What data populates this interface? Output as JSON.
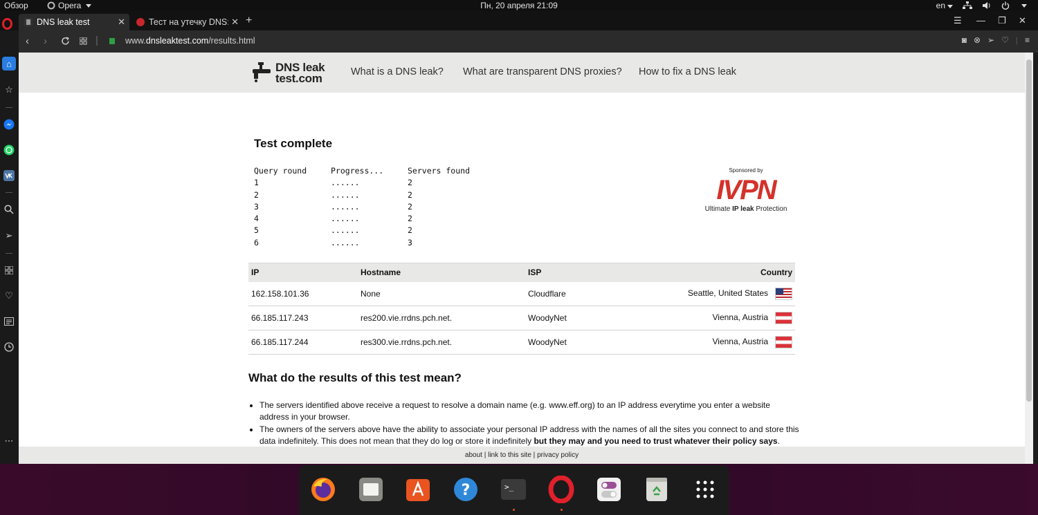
{
  "system": {
    "overview_label": "Обзор",
    "app_menu_label": "Opera",
    "clock": "Пн, 20 апреля  21:09",
    "keyboard_layout": "en"
  },
  "browser": {
    "tabs": [
      {
        "label": "DNS leak test",
        "active": true
      },
      {
        "label": "Тест на утечку DNS: Ка",
        "active": false
      }
    ],
    "new_tab_label": "+",
    "url_prefix": "www.",
    "url_host": "dnsleaktest.com",
    "url_path": "/results.html"
  },
  "site": {
    "logo_line1": "DNS leak",
    "logo_line2": "test.com",
    "nav": [
      "What is a DNS leak?",
      "What are transparent DNS proxies?",
      "How to fix a DNS leak"
    ]
  },
  "test": {
    "title": "Test complete",
    "query_headers": [
      "Query round",
      "Progress...",
      "Servers found"
    ],
    "query_rows": [
      [
        "1",
        "......",
        "2"
      ],
      [
        "2",
        "......",
        "2"
      ],
      [
        "3",
        "......",
        "2"
      ],
      [
        "4",
        "......",
        "2"
      ],
      [
        "5",
        "......",
        "2"
      ],
      [
        "6",
        "......",
        "3"
      ]
    ]
  },
  "sponsor": {
    "by": "Sponsored by",
    "brand": "IVPN",
    "tagline_pre": "Ultimate ",
    "tagline_bold": "IP leak",
    "tagline_post": " Protection"
  },
  "results": {
    "headers": {
      "ip": "IP",
      "hostname": "Hostname",
      "isp": "ISP",
      "country": "Country"
    },
    "rows": [
      {
        "ip": "162.158.101.36",
        "hostname": "None",
        "isp": "Cloudflare",
        "country": "Seattle, United States",
        "flag": "us"
      },
      {
        "ip": "66.185.117.243",
        "hostname": "res200.vie.rrdns.pch.net.",
        "isp": "WoodyNet",
        "country": "Vienna, Austria",
        "flag": "at"
      },
      {
        "ip": "66.185.117.244",
        "hostname": "res300.vie.rrdns.pch.net.",
        "isp": "WoodyNet",
        "country": "Vienna, Austria",
        "flag": "at"
      }
    ]
  },
  "meaning": {
    "title": "What do the results of this test mean?",
    "item1": "The servers identified above receive a request to resolve a domain name (e.g. www.eff.org) to an IP address everytime you enter a website address in your browser.",
    "item2_pre": "The owners of the servers above have the ability to associate your personal IP address with the names of all the sites you connect to and store this data indefinitely. This does not mean that they do log or store it indefinitely ",
    "item2_bold": "but they may and you need to trust whatever their policy says",
    "item2_post": "."
  },
  "footer": {
    "about": "about",
    "sep1": " | ",
    "link": "link to this site",
    "sep2": " | ",
    "privacy": "privacy policy"
  },
  "dock": {
    "apps": [
      "firefox-icon",
      "files-icon",
      "software-icon",
      "help-icon",
      "terminal-icon",
      "opera-icon",
      "settings-icon",
      "trash-icon",
      "app-grid-icon"
    ],
    "terminal_glyph": ">_"
  },
  "colors": {
    "accent": "#2a7de1",
    "opera_red": "#e0202b",
    "ivpn_red": "#d3322b",
    "dock_bg": "#2c0827"
  }
}
